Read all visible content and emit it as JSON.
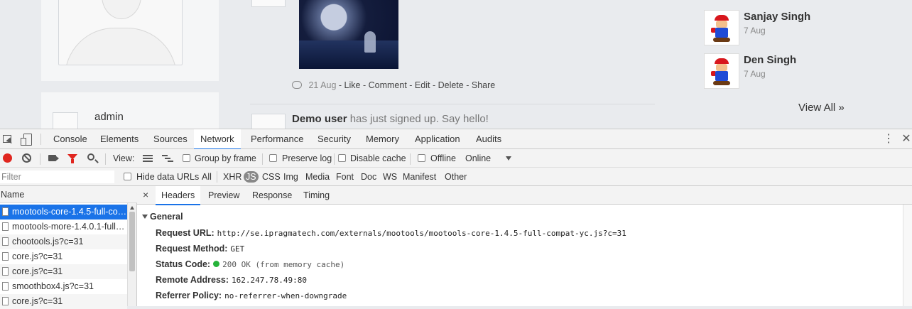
{
  "page": {
    "sidebar": {
      "admin_name": "admin"
    },
    "post": {
      "date": "21 Aug",
      "actions": [
        "Like",
        "Comment",
        "Edit",
        "Delete",
        "Share"
      ]
    },
    "signup": {
      "user": "Demo user",
      "text": "has just signed up. Say hello!"
    },
    "members": [
      {
        "name": "Sanjay Singh",
        "date": "7 Aug"
      },
      {
        "name": "Den Singh",
        "date": "7 Aug"
      }
    ],
    "view_all": "View All »"
  },
  "devtools": {
    "tabs": [
      "Console",
      "Elements",
      "Sources",
      "Network",
      "Performance",
      "Security",
      "Memory",
      "Application",
      "Audits"
    ],
    "active_tab": "Network",
    "toolbar": {
      "view_label": "View:",
      "group_by_frame": "Group by frame",
      "preserve_log": "Preserve log",
      "disable_cache": "Disable cache",
      "offline": "Offline",
      "throttle_value": "Online"
    },
    "filter": {
      "placeholder": "Filter",
      "hide_data_urls": "Hide data URLs",
      "types": [
        "All",
        "XHR",
        "JS",
        "CSS",
        "Img",
        "Media",
        "Font",
        "Doc",
        "WS",
        "Manifest",
        "Other"
      ],
      "active_type": "JS"
    },
    "requests": {
      "header": "Name",
      "rows": [
        "mootools-core-1.4.5-full-com...",
        "mootools-more-1.4.0.1-full-c...",
        "chootools.js?c=31",
        "core.js?c=31",
        "core.js?c=31",
        "smoothbox4.js?c=31",
        "core.js?c=31"
      ]
    },
    "details": {
      "close": "×",
      "tabs": [
        "Headers",
        "Preview",
        "Response",
        "Timing"
      ],
      "active_tab": "Headers",
      "section": "General",
      "fields": [
        {
          "key": "Request URL:",
          "value": "http://se.ipragmatech.com/externals/mootools/mootools-core-1.4.5-full-compat-yc.js?c=31"
        },
        {
          "key": "Request Method:",
          "value": "GET"
        },
        {
          "key": "Status Code:",
          "value": "200 OK (from memory cache)"
        },
        {
          "key": "Remote Address:",
          "value": "162.247.78.49:80"
        },
        {
          "key": "Referrer Policy:",
          "value": "no-referrer-when-downgrade"
        }
      ]
    }
  },
  "colors": {
    "accent": "#1a73e8",
    "record": "#e0261f",
    "status_ok": "#26b33a"
  }
}
